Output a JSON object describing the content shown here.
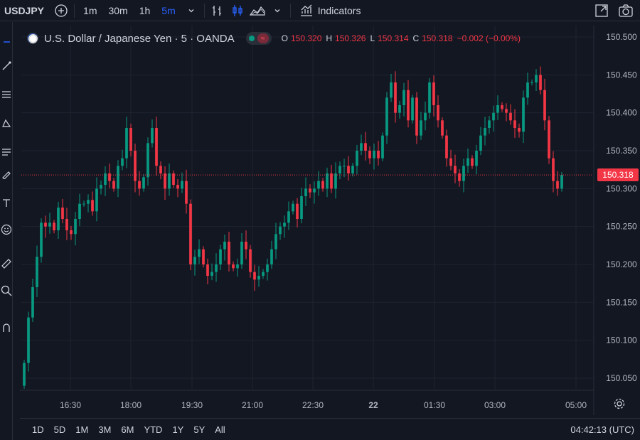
{
  "toolbar": {
    "symbol": "USDJPY",
    "timeframes": [
      "1m",
      "30m",
      "1h",
      "5m"
    ],
    "active_timeframe": "5m",
    "indicators_label": "Indicators"
  },
  "legend": {
    "name": "U.S. Dollar / Japanese Yen · 5 · OANDA",
    "pill_symbol": "≈",
    "o_label": "O",
    "o_value": "150.320",
    "h_label": "H",
    "h_value": "150.326",
    "l_label": "L",
    "l_value": "150.314",
    "c_label": "C",
    "c_value": "150.318",
    "change": "−0.002 (−0.00%)"
  },
  "price_tag": "150.318",
  "bottom": {
    "ranges": [
      "1D",
      "5D",
      "1M",
      "3M",
      "6M",
      "YTD",
      "1Y",
      "5Y",
      "All"
    ],
    "clock": "04:42:13 (UTC)"
  },
  "colors": {
    "up": "#089981",
    "down": "#f23645",
    "background": "#131722",
    "grid": "#1f2330",
    "accent": "#2962ff"
  },
  "chart_data": {
    "type": "candlestick",
    "title": "",
    "x_ticks": [
      "16:30",
      "18:00",
      "19:30",
      "21:00",
      "22:30",
      "22",
      "01:30",
      "03:00",
      "05:00"
    ],
    "y_ticks": [
      150.5,
      150.45,
      150.4,
      150.35,
      150.3,
      150.25,
      150.2,
      150.15,
      150.1,
      150.05
    ],
    "ylim": [
      150.035,
      150.515
    ],
    "last_price": 150.318,
    "grid": true,
    "close_series": [
      150.07,
      150.13,
      150.17,
      150.21,
      150.255,
      150.25,
      150.255,
      150.245,
      150.275,
      150.26,
      150.245,
      150.24,
      150.26,
      150.28,
      150.28,
      150.285,
      150.27,
      150.3,
      150.305,
      150.32,
      150.31,
      150.3,
      150.33,
      150.34,
      150.38,
      150.35,
      150.31,
      150.3,
      150.315,
      150.36,
      150.38,
      150.33,
      150.32,
      150.3,
      150.32,
      150.305,
      150.3,
      150.31,
      150.28,
      150.2,
      150.21,
      150.22,
      150.2,
      150.185,
      150.19,
      150.2,
      150.22,
      150.23,
      150.2,
      150.195,
      150.2,
      150.23,
      150.22,
      150.19,
      150.18,
      150.185,
      150.19,
      150.2,
      150.22,
      150.24,
      150.25,
      150.255,
      150.27,
      150.28,
      150.26,
      150.29,
      150.3,
      150.295,
      150.3,
      150.31,
      150.3,
      150.32,
      150.3,
      150.32,
      150.33,
      150.33,
      150.32,
      150.33,
      150.35,
      150.36,
      150.35,
      150.34,
      150.35,
      150.34,
      150.37,
      150.42,
      150.44,
      150.4,
      150.41,
      150.43,
      150.39,
      150.42,
      150.37,
      150.39,
      150.4,
      150.44,
      150.41,
      150.39,
      150.37,
      150.34,
      150.33,
      150.32,
      150.31,
      150.33,
      150.34,
      150.33,
      150.35,
      150.37,
      150.38,
      150.39,
      150.4,
      150.41,
      150.405,
      150.4,
      150.39,
      150.38,
      150.375,
      150.42,
      150.44,
      150.44,
      150.45,
      150.43,
      150.39,
      150.34,
      150.31,
      150.3,
      150.318
    ]
  }
}
